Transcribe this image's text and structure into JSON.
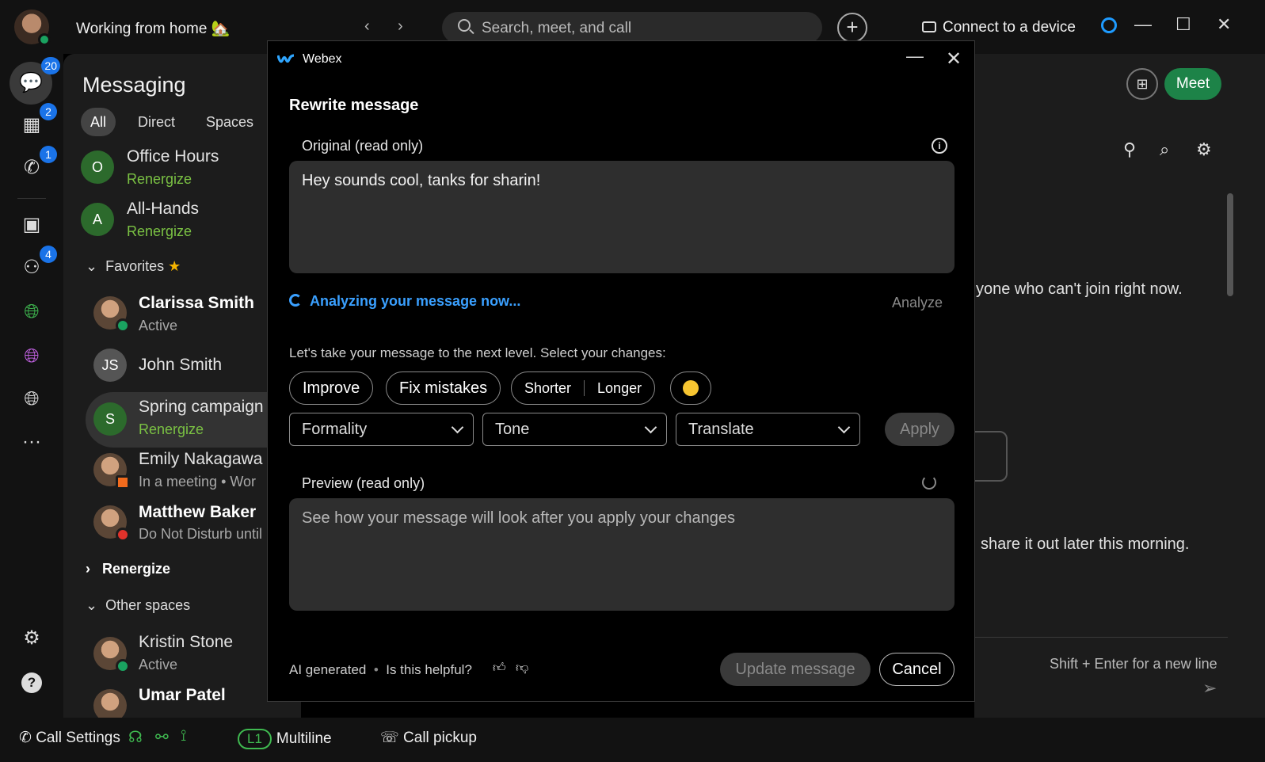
{
  "topbar": {
    "status": "Working from home 🏡",
    "nav_back": "‹",
    "nav_forward": "›",
    "search_placeholder": "Search, meet, and call",
    "plus": "+",
    "connect": "Connect to a device",
    "minimize": "—",
    "maximize": "☐",
    "close": "✕"
  },
  "rail": {
    "messaging_badge": "20",
    "calendar_badge": "2",
    "calls_badge": "1",
    "teams_badge": "4",
    "more": "···"
  },
  "messaging": {
    "title": "Messaging",
    "filters": [
      "All",
      "Direct",
      "Spaces"
    ],
    "rows": [
      {
        "initial": "O",
        "name": "Office Hours",
        "sub": "Renergize"
      },
      {
        "initial": "A",
        "name": "All-Hands",
        "sub": "Renergize"
      }
    ],
    "favorites_label": "Favorites",
    "favorites": [
      {
        "name": "Clarissa Smith",
        "sub": "Active"
      },
      {
        "initial": "JS",
        "name": "John Smith"
      },
      {
        "initial": "S",
        "name": "Spring campaign",
        "sub": "Renergize"
      },
      {
        "name": "Emily Nakagawa",
        "sub": "In a meeting  •  Wor"
      },
      {
        "name": "Matthew Baker",
        "sub": "Do Not Disturb until"
      }
    ],
    "renergize_label": "Renergize",
    "other_spaces_label": "Other spaces",
    "other": [
      {
        "name": "Kristin Stone",
        "sub": "Active"
      },
      {
        "name": "Umar Patel"
      }
    ]
  },
  "chat": {
    "meet_label": "Meet",
    "line1": "yone who can't join right now.",
    "line2": "share it out later this morning.",
    "hint": "Shift + Enter for a new line"
  },
  "bottombar": {
    "call_settings": "Call Settings",
    "line": "L1",
    "multiline": "Multiline",
    "call_pickup": "Call pickup"
  },
  "dialog": {
    "app_name": "Webex",
    "title": "Rewrite message",
    "original_label": "Original (read only)",
    "original_text": "Hey sounds cool, tanks for sharin!",
    "analyzing": "Analyzing your message now...",
    "analyze_link": "Analyze",
    "instructions": "Let's take your message to the next level. Select your changes:",
    "chips": {
      "improve": "Improve",
      "fix_mistakes": "Fix mistakes",
      "shorter": "Shorter",
      "longer": "Longer"
    },
    "selects": {
      "formality": "Formality",
      "tone": "Tone",
      "translate": "Translate"
    },
    "apply": "Apply",
    "preview_label": "Preview (read only)",
    "preview_placeholder": "See how your message will look after you apply your changes",
    "footer_ai": "AI generated",
    "footer_helpful": "Is this helpful?",
    "update_button": "Update message",
    "cancel_button": "Cancel"
  }
}
